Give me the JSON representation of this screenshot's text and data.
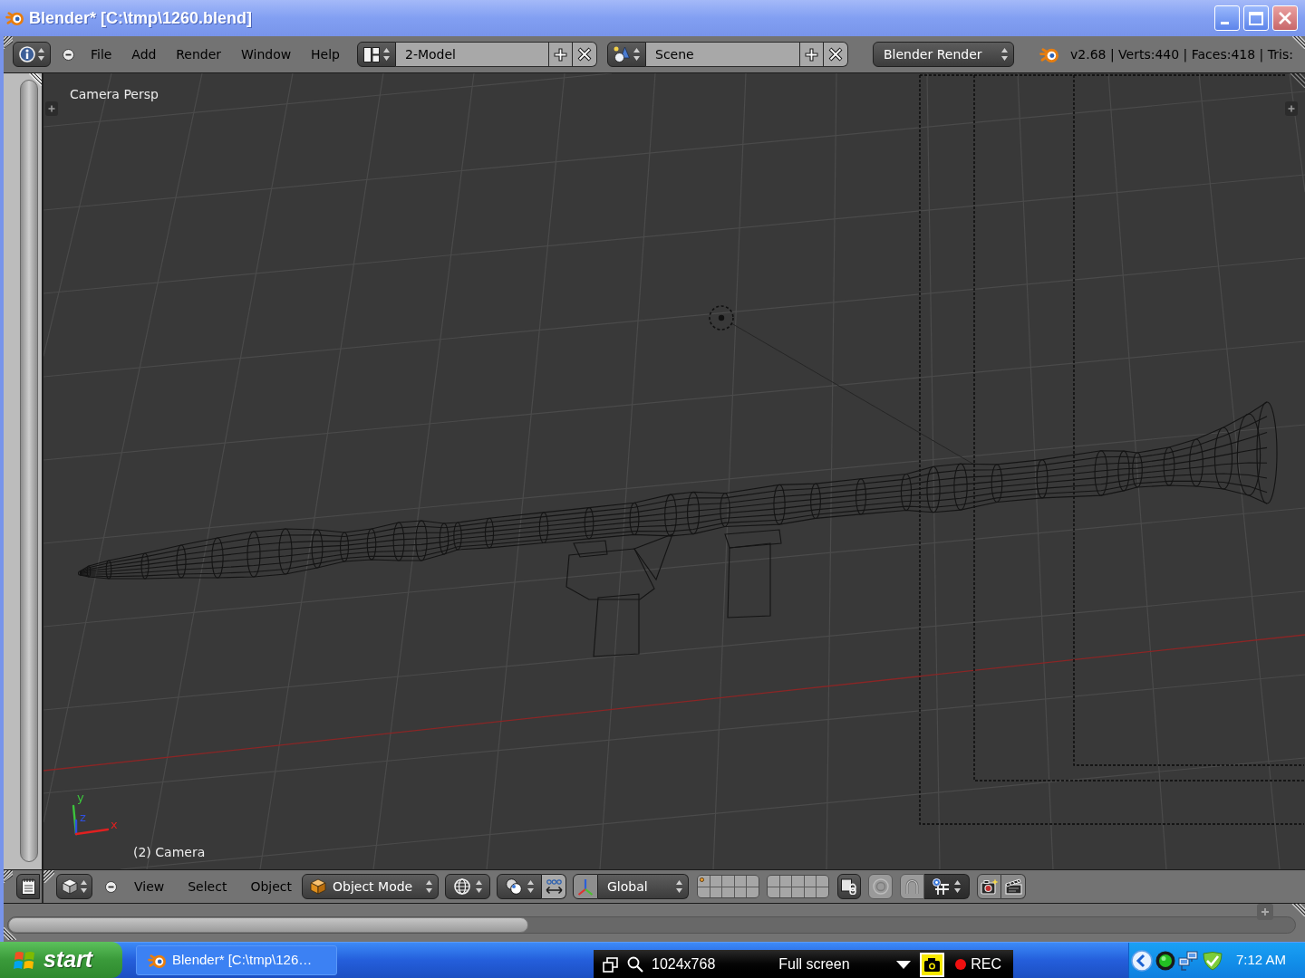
{
  "window": {
    "title": "Blender* [C:\\tmp\\1260.blend]"
  },
  "info_header": {
    "menus": [
      "File",
      "Add",
      "Render",
      "Window",
      "Help"
    ],
    "screen_layout": "2-Model",
    "scene": "Scene",
    "render_engine": "Blender Render",
    "stats": "v2.68 | Verts:440 | Faces:418 | Tris:"
  },
  "viewport": {
    "view_name": "Camera Persp",
    "active_object": "(2) Camera",
    "axes": [
      {
        "label": "y",
        "color": "#3cc43c"
      },
      {
        "label": "z",
        "color": "#2f4fe0"
      },
      {
        "label": "x",
        "color": "#e02020"
      }
    ]
  },
  "view3d_header": {
    "menus": [
      "View",
      "Select",
      "Object"
    ],
    "mode": "Object Mode",
    "manipulator": {
      "on": true
    },
    "orientation": "Global",
    "layers": [
      {
        "occupied": true
      },
      {
        "occupied": false
      },
      {
        "occupied": false
      },
      {
        "occupied": false
      },
      {
        "occupied": false
      },
      {
        "occupied": false
      },
      {
        "occupied": false
      },
      {
        "occupied": false
      },
      {
        "occupied": false
      },
      {
        "occupied": false
      },
      {
        "occupied": false
      },
      {
        "occupied": false
      },
      {
        "occupied": false
      },
      {
        "occupied": false
      },
      {
        "occupied": false
      },
      {
        "occupied": false
      },
      {
        "occupied": false
      },
      {
        "occupied": false
      },
      {
        "occupied": false
      },
      {
        "occupied": false
      }
    ]
  },
  "taskbar": {
    "start_label": "start",
    "tasks": [
      {
        "label": "Blender* [C:\\tmp\\126…",
        "selected": false
      }
    ],
    "recorder": {
      "resolution": "1024x768",
      "mode": "Full screen",
      "record_label": "REC"
    },
    "clock": "7:12 AM"
  }
}
